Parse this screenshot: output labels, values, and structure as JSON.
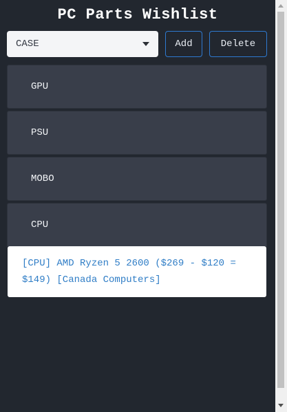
{
  "app": {
    "title": "PC Parts Wishlist"
  },
  "controls": {
    "category_select_value": "CASE",
    "add_label": "Add",
    "delete_label": "Delete"
  },
  "parts": [
    {
      "label": "GPU"
    },
    {
      "label": "PSU"
    },
    {
      "label": "MOBO"
    },
    {
      "label": "CPU"
    }
  ],
  "expanded_detail": {
    "text": "[CPU] AMD Ryzen 5 2600 ($269 - $120 = $149) [Canada Computers]"
  },
  "colors": {
    "background": "#22272f",
    "item_background": "#393e4a",
    "accent": "#2e7ad1",
    "link": "#2f7dc6"
  },
  "icons": {
    "select_caret": "caret-down-icon",
    "scroll_up": "scroll-up-arrow-icon",
    "scroll_down": "scroll-down-arrow-icon"
  }
}
